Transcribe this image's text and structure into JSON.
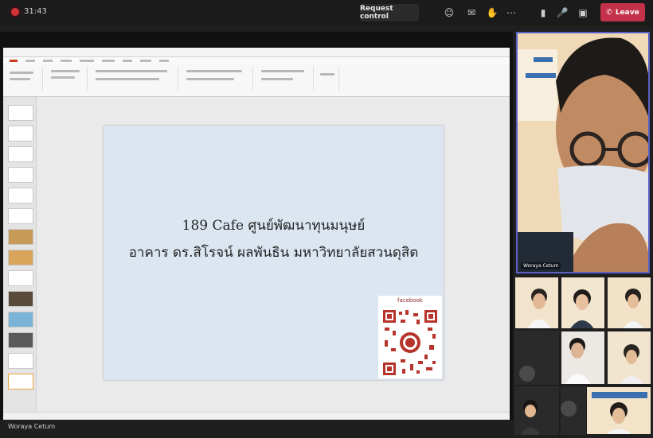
{
  "meeting": {
    "timer": "31:43",
    "request_control_label": "Request control",
    "leave_label": "Leave",
    "presenter_name": "Woraya Cetum"
  },
  "slide": {
    "line1": "189 Cafe ศูนย์พัฒนาทุนมนุษย์",
    "line2": "อาคาร ดร.สิโรจน์ ผลพันธิน มหาวิทยาลัยสวนดุสิต",
    "qr_label": "facebook"
  },
  "video": {
    "main_tile_name": "Woraya Cetum"
  },
  "colors": {
    "leave_red": "#c4314b",
    "record_red": "#d13438",
    "slide_bg": "#dce6f1",
    "qr_red": "#b7342b",
    "active_speaker_border": "#5b5fc7"
  },
  "icons": [
    "record-icon",
    "people-icon",
    "chat-icon",
    "raise-hand-icon",
    "more-icon",
    "camera-icon",
    "mic-icon",
    "share-icon",
    "phone-icon"
  ]
}
